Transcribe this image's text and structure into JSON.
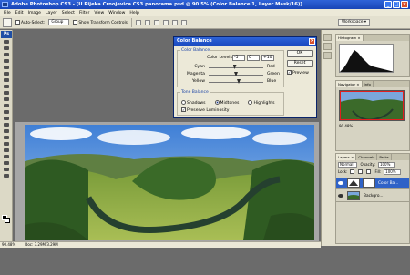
{
  "window": {
    "title": "Adobe Photoshop CS3 - [U Rijeka Crnojevica CS3 panorama.psd @ 90.5% (Color Balance 1, Layer Mask/16)]"
  },
  "menu": [
    "File",
    "Edit",
    "Image",
    "Layer",
    "Select",
    "Filter",
    "View",
    "Window",
    "Help"
  ],
  "options_bar": {
    "auto_select_label": "Auto-Select:",
    "auto_select_value": "Group",
    "show_transform_label": "Show Transform Controls",
    "workspace_label": "Workspace ▾"
  },
  "toolbox": {
    "logo": "Ps"
  },
  "dialog": {
    "title": "Color Balance",
    "group_color": "Color Balance",
    "levels_label": "Color Levels:",
    "levels": [
      "-5",
      "0",
      "+10"
    ],
    "sliders": [
      {
        "left": "Cyan",
        "right": "Red",
        "value": -5
      },
      {
        "left": "Magenta",
        "right": "Green",
        "value": 0
      },
      {
        "left": "Yellow",
        "right": "Blue",
        "value": 10
      }
    ],
    "group_tone": "Tone Balance",
    "tones": [
      "Shadows",
      "Midtones",
      "Highlights"
    ],
    "selected_tone": "Midtones",
    "preserve_label": "Preserve Luminosity",
    "ok": "OK",
    "reset": "Reset",
    "preview_label": "Preview"
  },
  "status": {
    "zoom": "90.48%",
    "doc": "Doc: 3.29M/3.29M"
  },
  "panels": {
    "histogram_tabs": [
      "Histogram ×"
    ],
    "navigator_tabs": [
      "Navigator ×",
      "Info"
    ],
    "nav_zoom": "90.48%",
    "layers_tabs": [
      "Layers ×",
      "Channels",
      "Paths"
    ],
    "blend_mode": "Normal",
    "opacity_label": "Opacity:",
    "opacity": "100%",
    "lock_label": "Lock:",
    "fill_label": "Fill:",
    "fill": "100%",
    "layers": [
      {
        "name": "Color Ba...",
        "selected": true
      },
      {
        "name": "Backgro...",
        "selected": false
      }
    ]
  },
  "colors": {
    "title_blue": "#1945b7",
    "selected_layer": "#2f62c7",
    "nav_frame": "#e01f1f"
  }
}
